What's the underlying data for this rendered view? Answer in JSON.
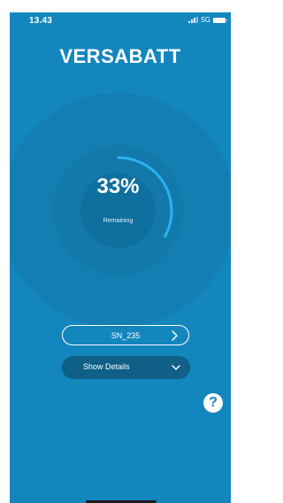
{
  "status_bar": {
    "time": "13.43",
    "network": "5G"
  },
  "brand": {
    "logo_text": "VERSABATT"
  },
  "battery": {
    "percent_text": "33%",
    "remaining_label": "Remaining",
    "percent_value": 33
  },
  "device": {
    "serial_label": "SN_235"
  },
  "details": {
    "show_label": "Show Details"
  },
  "help": {
    "glyph": "?"
  },
  "icons": {
    "signal": "signal-icon",
    "battery": "battery-icon",
    "chevron_right": "chevron-right-icon",
    "chevron_down": "chevron-down-icon",
    "help": "help-icon"
  },
  "colors": {
    "background": "#1386be",
    "progress": "#29b3f0",
    "details_button": "#0f5f87"
  }
}
